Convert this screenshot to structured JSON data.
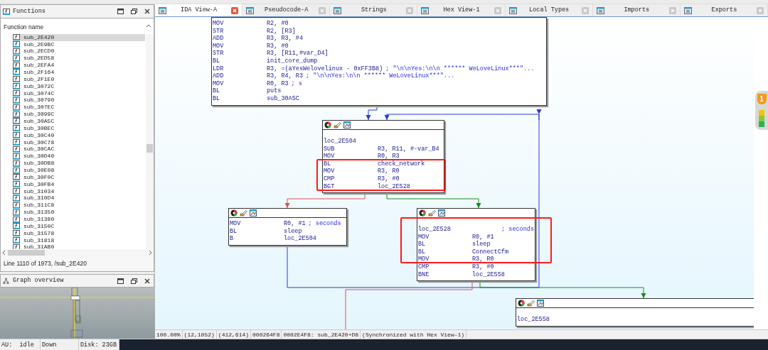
{
  "functions_panel": {
    "title": "Functions",
    "column": "Function name",
    "items": [
      {
        "name": "sub_2E420",
        "selected": true
      },
      {
        "name": "sub_2E9BC",
        "selected": false
      },
      {
        "name": "sub_2ECD0",
        "selected": false
      },
      {
        "name": "sub_2ED58",
        "selected": false
      },
      {
        "name": "sub_2EFA4",
        "selected": false
      },
      {
        "name": "sub_2F164",
        "selected": false
      },
      {
        "name": "sub_2F1E0",
        "selected": false
      },
      {
        "name": "sub_3072C",
        "selected": false
      },
      {
        "name": "sub_3074C",
        "selected": false
      },
      {
        "name": "sub_30790",
        "selected": false
      },
      {
        "name": "sub_307EC",
        "selected": false
      },
      {
        "name": "sub_3099C",
        "selected": false
      },
      {
        "name": "sub_30A5C",
        "selected": false
      },
      {
        "name": "sub_30BEC",
        "selected": false
      },
      {
        "name": "sub_30C40",
        "selected": false
      },
      {
        "name": "sub_30C78",
        "selected": false
      },
      {
        "name": "sub_30CAC",
        "selected": false
      },
      {
        "name": "sub_30D40",
        "selected": false
      },
      {
        "name": "sub_30DB8",
        "selected": false
      },
      {
        "name": "sub_30E08",
        "selected": false
      },
      {
        "name": "sub_30F0C",
        "selected": false
      },
      {
        "name": "sub_30FB4",
        "selected": false
      },
      {
        "name": "sub_31034",
        "selected": false
      },
      {
        "name": "sub_310D4",
        "selected": false
      },
      {
        "name": "sub_311C8",
        "selected": false
      },
      {
        "name": "sub_31350",
        "selected": false
      },
      {
        "name": "sub_31380",
        "selected": false
      },
      {
        "name": "sub_3150C",
        "selected": false
      },
      {
        "name": "sub_31578",
        "selected": false
      },
      {
        "name": "sub_31818",
        "selected": false
      },
      {
        "name": "sub_31AB0",
        "selected": false
      }
    ],
    "line_info": "Line 1110 of 1973, /sub_2E420"
  },
  "graph_overview": {
    "title": "Graph overview"
  },
  "status_bar": [
    "AU:  idle",
    "Down",
    "Disk: 23GB"
  ],
  "tabs": [
    {
      "label": "IDA View-A",
      "selected": true
    },
    {
      "label": "Pseudocode-A",
      "selected": false
    },
    {
      "label": "Strings",
      "selected": false
    },
    {
      "label": "Hex View-1",
      "selected": false
    },
    {
      "label": "Local Types",
      "selected": false
    },
    {
      "label": "Imports",
      "selected": false
    },
    {
      "label": "Exports",
      "selected": false
    }
  ],
  "blocks": [
    {
      "header": false,
      "lines": [
        {
          "op": "MOV",
          "args": "R2, #0"
        },
        {
          "op": "STR",
          "args": "R2, [R3]"
        },
        {
          "op": "ADD",
          "args": "R3, R3, #4"
        },
        {
          "op": "MOV",
          "args": "R3, #0"
        },
        {
          "op": "STR",
          "args": "R3, [R11,#var_D4]"
        },
        {
          "op": "BL",
          "args": "init_core_dump"
        },
        {
          "op": "LDR",
          "args": "R3, =(aYesWelovelinux - 0xFF3B8)",
          "comment": "; \"\\n\\nYes:\\n\\n      ****** WeLoveLinux***\"..."
        },
        {
          "op": "ADD",
          "args": "R3, R4, R3",
          "comment": "; \"\\n\\nYes:\\n\\n      ****** WeLoveLinux***\"..."
        },
        {
          "op": "MOV",
          "args": "R0, R3",
          "comment": "; s"
        },
        {
          "op": "BL",
          "args": "puts"
        },
        {
          "op": "BL",
          "args": "sub_30A5C"
        }
      ]
    },
    {
      "header": true,
      "label": "loc_2E504",
      "lines": [
        {
          "op": "SUB",
          "args": "R3, R11, #-var_B4"
        },
        {
          "op": "MOV",
          "args": "R0, R3"
        },
        {
          "op": "BL",
          "args": "check_network"
        },
        {
          "op": "MOV",
          "args": "R3, R0"
        },
        {
          "op": "CMP",
          "args": "R3, #0"
        },
        {
          "op": "BGT",
          "args": "loc_2E528"
        }
      ]
    },
    {
      "header": true,
      "lines": [
        {
          "op": "MOV",
          "args": "R0, #1",
          "comment": "; seconds"
        },
        {
          "op": "BL",
          "args": "sleep"
        },
        {
          "op": "B",
          "args": "loc_2E504"
        }
      ]
    },
    {
      "header": true,
      "label": "loc_2E528",
      "label_comment": "; seconds",
      "lines": [
        {
          "op": "MOV",
          "args": "R0, #1"
        },
        {
          "op": "BL",
          "args": "sleep"
        },
        {
          "op": "BL",
          "args": "ConnectCfm"
        },
        {
          "op": "MOV",
          "args": "R3, R0"
        },
        {
          "op": "CMP",
          "args": "R3, #0"
        },
        {
          "op": "BNE",
          "args": "loc_2E558"
        }
      ]
    },
    {
      "header": true,
      "label": "loc_2E558"
    }
  ],
  "graph_status": [
    "100.00%",
    "(12,1052)",
    "(412,614)",
    "000264F8",
    "0002E4F8: sub_2E420+D8",
    "(Synchronized with Hex View-1)"
  ],
  "security_badge": "1"
}
